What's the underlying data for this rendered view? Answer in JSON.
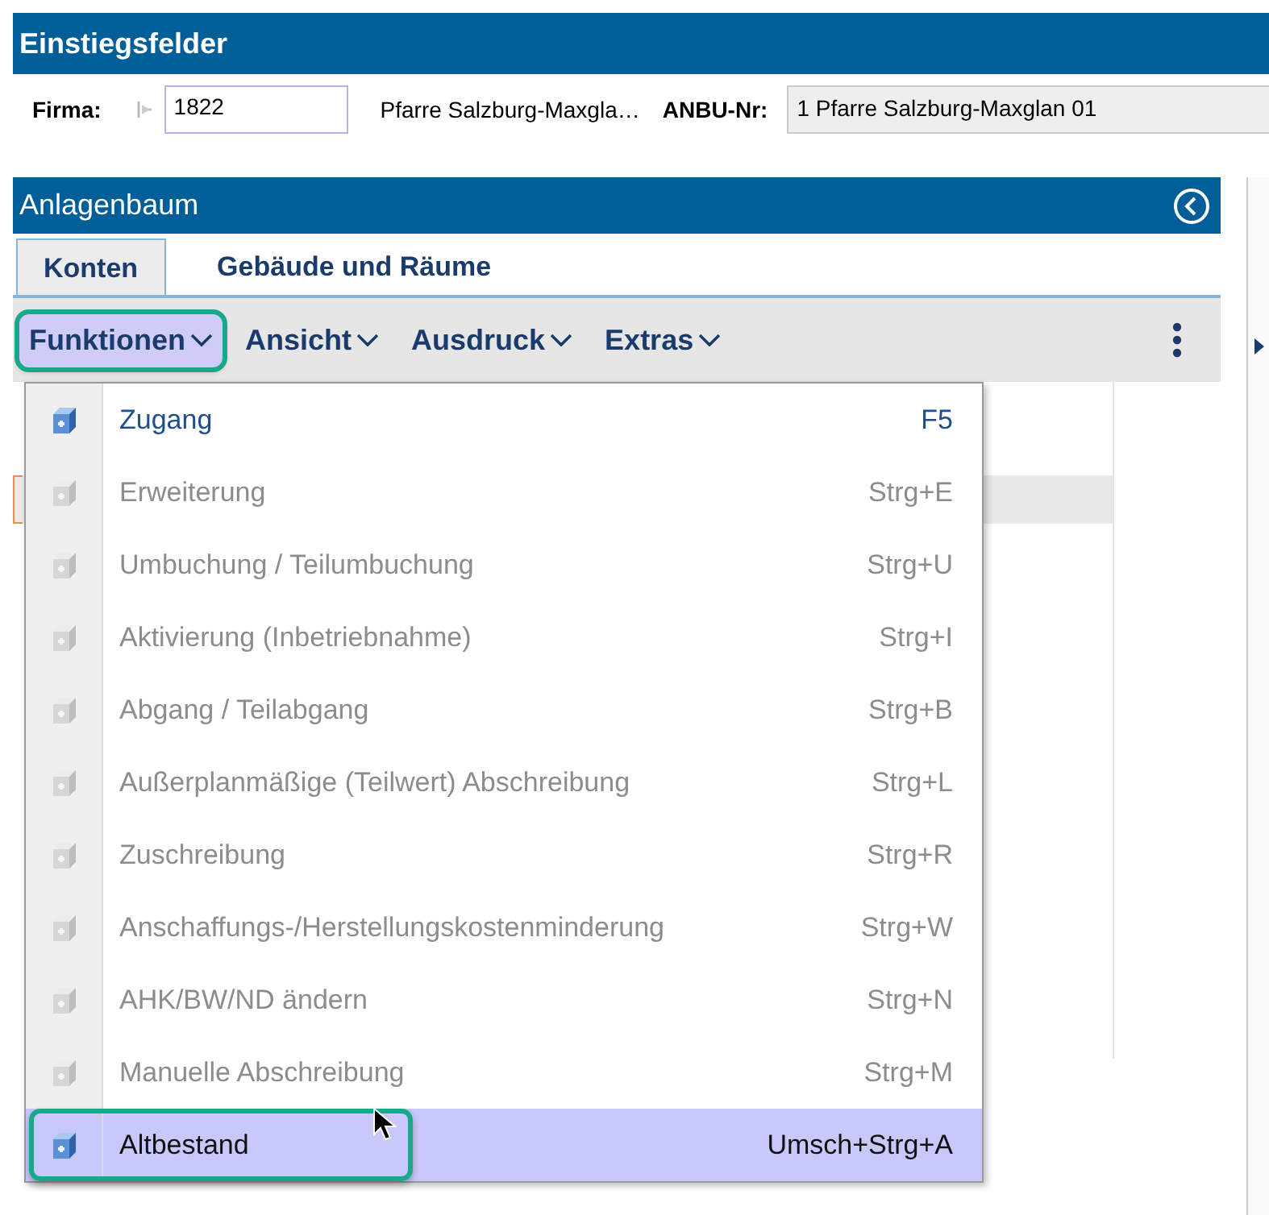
{
  "header": {
    "title": "Einstiegsfelder"
  },
  "fields": {
    "firma_label": "Firma:",
    "firma_value": "1822",
    "firma_name": "Pfarre Salzburg-Maxgla…",
    "anbu_label": "ANBU-Nr:",
    "anbu_value": "1 Pfarre Salzburg-Maxglan 01"
  },
  "panel": {
    "title": "Anlagenbaum"
  },
  "tabs": [
    {
      "label": "Konten",
      "selected": true
    },
    {
      "label": "Gebäude und Räume",
      "selected": false
    }
  ],
  "toolbar": [
    {
      "label": "Funktionen",
      "open": true,
      "highlighted": true
    },
    {
      "label": "Ansicht",
      "open": false,
      "highlighted": false
    },
    {
      "label": "Ausdruck",
      "open": false,
      "highlighted": false
    },
    {
      "label": "Extras",
      "open": false,
      "highlighted": false
    }
  ],
  "menu": {
    "items": [
      {
        "label": "Zugang",
        "shortcut": "F5",
        "disabled": false,
        "selected": false,
        "highlighted": false
      },
      {
        "label": "Erweiterung",
        "shortcut": "Strg+E",
        "disabled": true,
        "selected": false,
        "highlighted": false
      },
      {
        "label": "Umbuchung / Teilumbuchung",
        "shortcut": "Strg+U",
        "disabled": true,
        "selected": false,
        "highlighted": false
      },
      {
        "label": "Aktivierung (Inbetriebnahme)",
        "shortcut": "Strg+I",
        "disabled": true,
        "selected": false,
        "highlighted": false
      },
      {
        "label": "Abgang / Teilabgang",
        "shortcut": "Strg+B",
        "disabled": true,
        "selected": false,
        "highlighted": false
      },
      {
        "label": "Außerplanmäßige (Teilwert) Abschreibung",
        "shortcut": "Strg+L",
        "disabled": true,
        "selected": false,
        "highlighted": false
      },
      {
        "label": "Zuschreibung",
        "shortcut": "Strg+R",
        "disabled": true,
        "selected": false,
        "highlighted": false
      },
      {
        "label": "Anschaffungs-/Herstellungskostenminderung",
        "shortcut": "Strg+W",
        "disabled": true,
        "selected": false,
        "highlighted": false
      },
      {
        "label": "AHK/BW/ND ändern",
        "shortcut": "Strg+N",
        "disabled": true,
        "selected": false,
        "highlighted": false
      },
      {
        "label": "Manuelle Abschreibung",
        "shortcut": "Strg+M",
        "disabled": true,
        "selected": false,
        "highlighted": false
      },
      {
        "label": "Altbestand",
        "shortcut": "Umsch+Strg+A",
        "disabled": false,
        "selected": true,
        "highlighted": true
      }
    ]
  }
}
